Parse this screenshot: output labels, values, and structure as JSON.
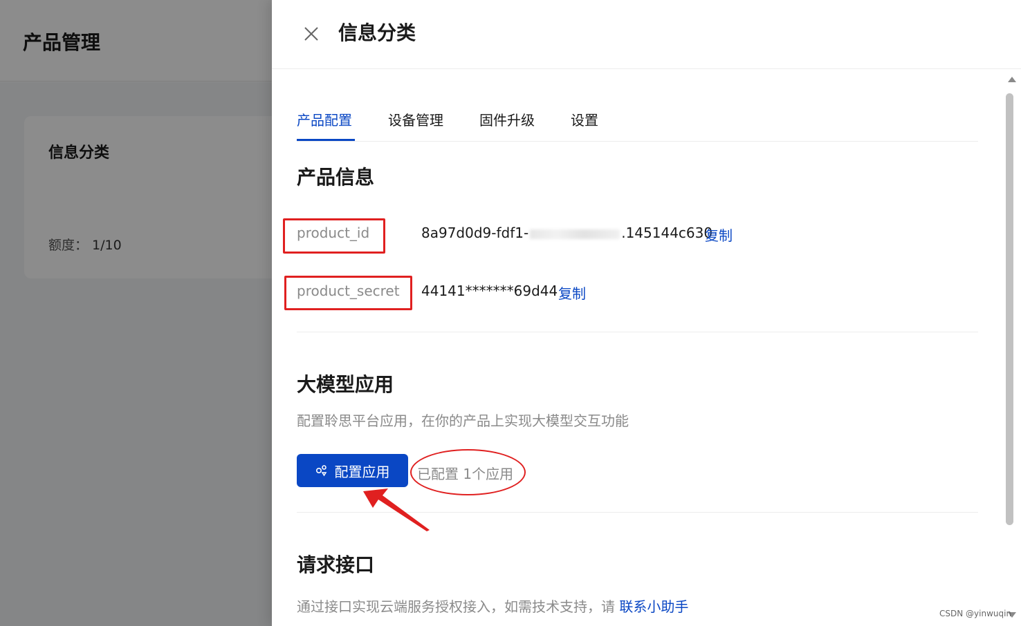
{
  "background": {
    "page_title": "产品管理",
    "card_title": "信息分类",
    "quota_label": "额度：",
    "quota_value": "1/10"
  },
  "drawer": {
    "title": "信息分类",
    "tabs": [
      {
        "label": "产品配置",
        "active": true
      },
      {
        "label": "设备管理",
        "active": false
      },
      {
        "label": "固件升级",
        "active": false
      },
      {
        "label": "设置",
        "active": false
      }
    ],
    "product_info": {
      "title": "产品信息",
      "product_id_label": "product_id",
      "product_id_value_start": "8a97d0d9-fdf1-",
      "product_id_value_end": ".145144c630",
      "product_secret_label": "product_secret",
      "product_secret_value": "44141*******69d44",
      "copy_label": "复制"
    },
    "llm_app": {
      "title": "大模型应用",
      "description": "配置聆思平台应用，在你的产品上实现大模型交互功能",
      "config_button": "配置应用",
      "configured_text": "已配置 1个应用"
    },
    "request_api": {
      "title": "请求接口",
      "description": "通过接口实现云端服务授权接入，如需技术支持，请",
      "contact_link": "联系小助手"
    }
  },
  "watermark": "CSDN @yinwuqin",
  "colors": {
    "accent": "#0a47c4",
    "annotation_red": "#e02020",
    "mask": "rgba(0,0,0,0.45)"
  },
  "icons": {
    "close": "close-icon",
    "config": "apps-icon",
    "scroll_up": "scroll-up-arrow-icon",
    "scroll_down": "scroll-down-arrow-icon",
    "annotation_arrow": "red-arrow-annotation-icon"
  }
}
